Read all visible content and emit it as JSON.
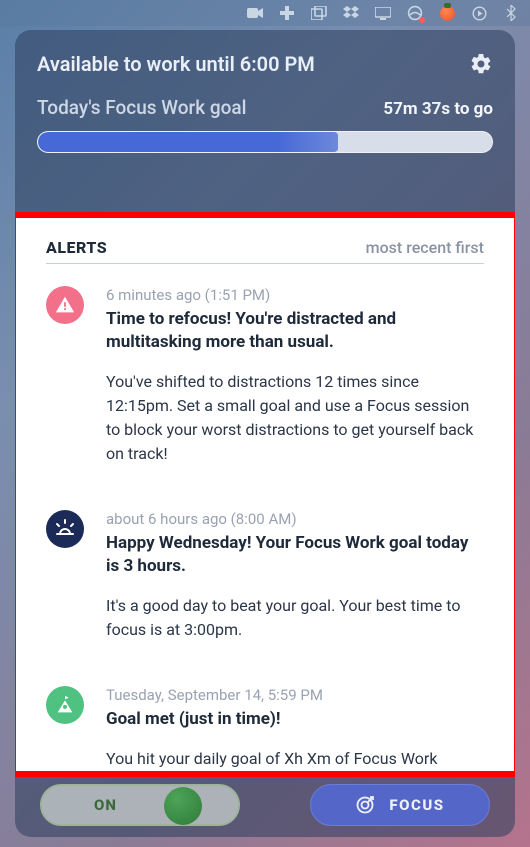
{
  "header": {
    "available_label": "Available to work until 6:00 PM",
    "goal_label": "Today's Focus Work goal",
    "remaining_label": "57m 37s to go",
    "progress_percent": 66
  },
  "alerts": {
    "title": "ALERTS",
    "sort_label": "most recent first",
    "items": [
      {
        "icon": "warning",
        "icon_bg": "ic-pink",
        "time": "6 minutes ago (1:51 PM)",
        "headline": "Time to refocus! You're distracted and multitasking more than usual.",
        "body": "You've shifted to distractions 12 times since 12:15pm. Set a small goal and use a Focus session to block your worst distractions to get yourself back on track!"
      },
      {
        "icon": "sunrise",
        "icon_bg": "ic-navy",
        "time": "about 6 hours ago (8:00 AM)",
        "headline": "Happy Wednesday! Your Focus Work goal today is 3 hours.",
        "body": "It's a good day to beat your goal. Your best time to focus is at 3:00pm."
      },
      {
        "icon": "flag-peak",
        "icon_bg": "ic-green",
        "time": "Tuesday, September 14, 5:59 PM",
        "headline": "Goal met (just in time)!",
        "body": "You hit your daily goal of Xh Xm of Focus Work"
      }
    ]
  },
  "footer": {
    "toggle_label": "ON",
    "focus_label": "FOCUS"
  },
  "menubar": {
    "icons": [
      "video-icon",
      "plus-icon",
      "windows-icon",
      "dropbox-icon",
      "display-icon",
      "status-icon",
      "tomato-icon",
      "play-circle-icon",
      "bluetooth-icon"
    ]
  }
}
